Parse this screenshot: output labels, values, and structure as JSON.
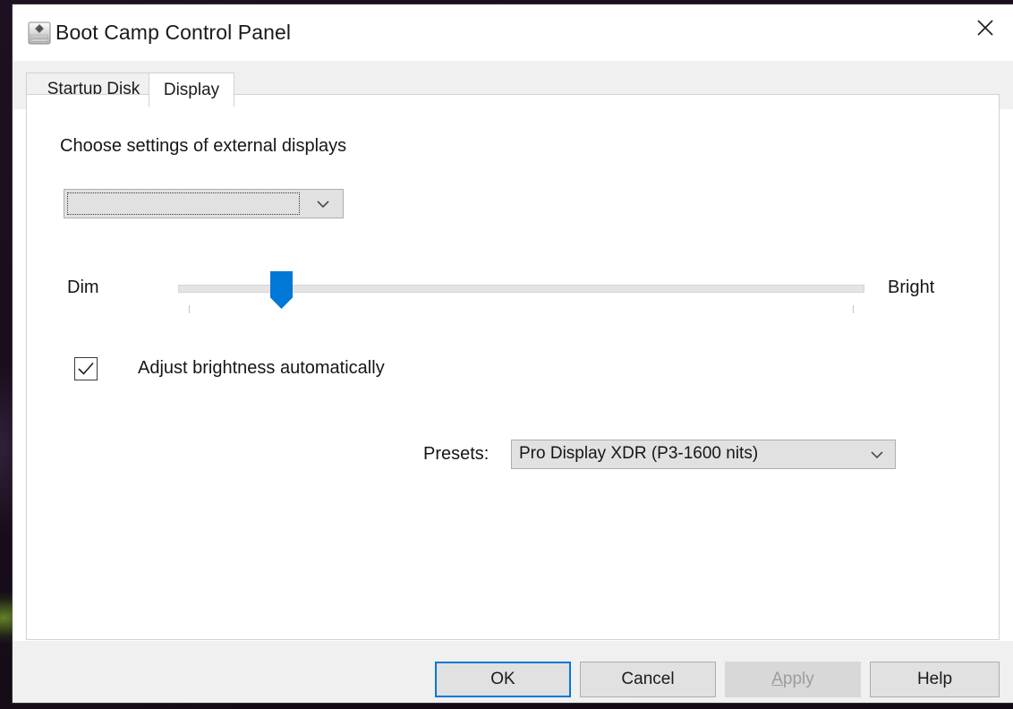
{
  "window": {
    "title": "Boot Camp Control Panel",
    "app_icon": "hard-drive-icon",
    "close_icon": "close-icon"
  },
  "tabs": [
    {
      "label": "Startup Disk",
      "active": false
    },
    {
      "label": "Display",
      "active": true
    }
  ],
  "display_tab": {
    "heading": "Choose settings of external displays",
    "display_select": {
      "value": "",
      "placeholder": "",
      "arrow_icon": "chevron-down-icon"
    },
    "brightness": {
      "min_label": "Dim",
      "max_label": "Bright",
      "thumb_icon": "slider-thumb"
    },
    "auto_brightness": {
      "label": "Adjust brightness automatically",
      "checked": true,
      "check_icon": "checkmark-icon"
    },
    "presets": {
      "label": "Presets:",
      "value": "Pro Display XDR (P3-1600 nits)",
      "arrow_icon": "chevron-down-icon"
    }
  },
  "footer": {
    "ok_label": "OK",
    "cancel_label": "Cancel",
    "apply_label": "Apply",
    "apply_accel": "A",
    "apply_rest": "pply",
    "help_label": "Help"
  },
  "colors": {
    "accent": "#0078d7",
    "window_bg": "#ffffff",
    "chrome_bg": "#f0f0f0",
    "control_bg": "#e1e1e1",
    "control_border": "#adadad",
    "disabled_text": "#9d9d9d"
  }
}
